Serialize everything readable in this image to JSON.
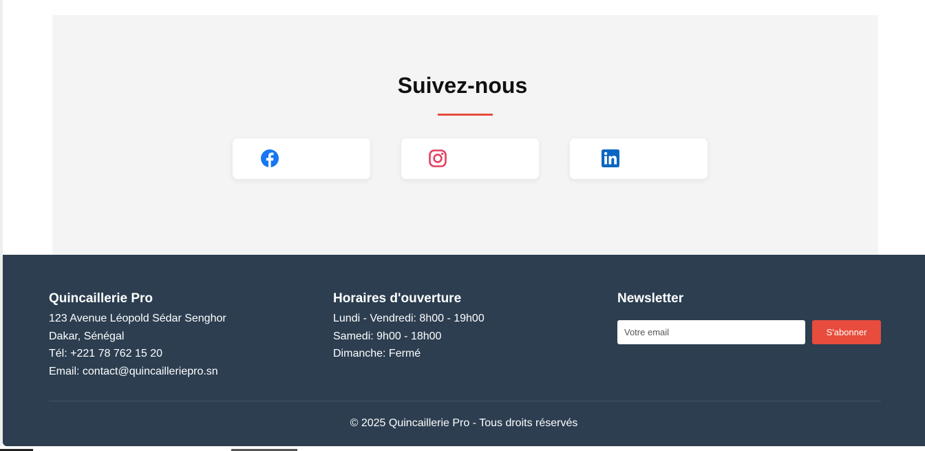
{
  "social": {
    "title": "Suivez-nous",
    "links": [
      {
        "name": "facebook",
        "icon": "facebook-icon",
        "color": "#1877f2"
      },
      {
        "name": "instagram",
        "icon": "instagram-icon",
        "color": "#e4405f"
      },
      {
        "name": "linkedin",
        "icon": "linkedin-icon",
        "color": "#0a66c2"
      }
    ],
    "accent_color": "#e74c3c",
    "background_color": "#f4f4f4"
  },
  "footer": {
    "background_color": "#2c3e50",
    "company": {
      "heading": "Quincaillerie Pro",
      "lines": [
        "123 Avenue Léopold Sédar Senghor",
        "Dakar, Sénégal",
        "Tél: +221 78 762 15 20",
        "Email: contact@quincailleriepro.sn"
      ]
    },
    "hours": {
      "heading": "Horaires d'ouverture",
      "lines": [
        "Lundi - Vendredi: 8h00 - 19h00",
        "Samedi: 9h00 - 18h00",
        "Dimanche: Fermé"
      ]
    },
    "newsletter": {
      "heading": "Newsletter",
      "placeholder": "Votre email",
      "button_label": "S'abonner",
      "button_color": "#e74c3c"
    },
    "copyright": "© 2025 Quincaillerie Pro - Tous droits réservés"
  }
}
